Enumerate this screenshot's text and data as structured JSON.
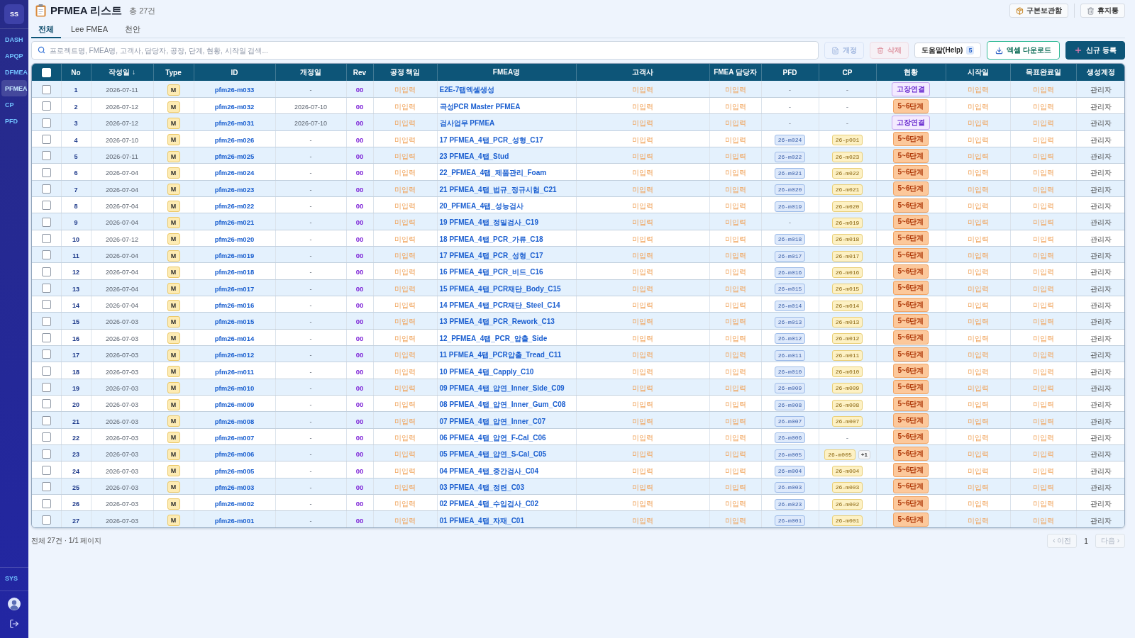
{
  "sidebar": {
    "logo": "SS",
    "items": [
      {
        "label": "DASH",
        "selected": false
      },
      {
        "label": "APQP",
        "selected": false
      },
      {
        "label": "DFMEA",
        "selected": false
      },
      {
        "label": "PFMEA",
        "selected": true
      },
      {
        "label": "CP",
        "selected": false
      },
      {
        "label": "PFD",
        "selected": false
      }
    ],
    "bottom_items": [
      {
        "label": "SYS",
        "selected": false
      }
    ]
  },
  "header": {
    "title": "PFMEA 리스트",
    "count": "총 27건",
    "actions": [
      {
        "label": "구본보관함",
        "kind": "archive"
      },
      {
        "label": "휴지통",
        "kind": "trash"
      }
    ]
  },
  "tabs": [
    {
      "label": "전체",
      "selected": true
    },
    {
      "label": "Lee FMEA",
      "selected": false
    },
    {
      "label": "천안",
      "selected": false
    }
  ],
  "search": {
    "placeholder": "프로젝트명, FMEA명, 고객사, 담당자, 공장, 단계, 현황, 시작일 검색..."
  },
  "toolbar": [
    {
      "label": "개정",
      "kind": "revise",
      "disabled": true
    },
    {
      "label": "삭제",
      "kind": "delete",
      "disabled": true
    },
    {
      "label": "도움말(Help)",
      "kind": "help",
      "disabled": false,
      "badge": "5"
    },
    {
      "label": "엑셀 다운로드",
      "kind": "excel",
      "disabled": false
    },
    {
      "label": "신규 등록",
      "kind": "create",
      "disabled": false
    }
  ],
  "table": {
    "select_all_checked": false,
    "columns": [
      "No",
      "작성일 ↓",
      "Type",
      "ID",
      "개정일",
      "Rev",
      "공정 책임",
      "FMEA명",
      "고객사",
      "FMEA 담당자",
      "PFD",
      "CP",
      "현황",
      "시작일",
      "목표완료일",
      "생성계정"
    ],
    "rows": [
      {
        "checked": false,
        "no": "1",
        "created": "2026-07-11",
        "type": "M",
        "id": "pfm26-m033",
        "revised": "-",
        "rev": "00",
        "process_owner": "미입력",
        "fmea_name": "E2E-7탭엑셀생성",
        "customer": "미입력",
        "fmea_owner": "미입력",
        "pfd": {
          "kind": "empty",
          "text": "-"
        },
        "cp": {
          "kind": "empty",
          "text": "-"
        },
        "status": {
          "kind": "link",
          "text": "고장연결"
        },
        "start": "미입력",
        "target": "미입력",
        "account": "관리자"
      },
      {
        "checked": false,
        "no": "2",
        "created": "2026-07-12",
        "type": "M",
        "id": "pfm26-m032",
        "revised": "2026-07-10",
        "rev": "00",
        "process_owner": "미입력",
        "fmea_name": "곡성PCR Master PFMEA",
        "customer": "미입력",
        "fmea_owner": "미입력",
        "pfd": {
          "kind": "empty",
          "text": "-"
        },
        "cp": {
          "kind": "empty",
          "text": "-"
        },
        "status": {
          "kind": "stage",
          "text": "5~6단계"
        },
        "start": "미입력",
        "target": "미입력",
        "account": "관리자"
      },
      {
        "checked": false,
        "no": "3",
        "created": "2026-07-12",
        "type": "M",
        "id": "pfm26-m031",
        "revised": "2026-07-10",
        "rev": "00",
        "process_owner": "미입력",
        "fmea_name": "검사업무 PFMEA",
        "customer": "미입력",
        "fmea_owner": "미입력",
        "pfd": {
          "kind": "empty",
          "text": "-"
        },
        "cp": {
          "kind": "empty",
          "text": "-"
        },
        "status": {
          "kind": "link",
          "text": "고장연결"
        },
        "start": "미입력",
        "target": "미입력",
        "account": "관리자"
      },
      {
        "checked": false,
        "no": "4",
        "created": "2026-07-10",
        "type": "M",
        "id": "pfm26-m026",
        "revised": "-",
        "rev": "00",
        "process_owner": "미입력",
        "fmea_name": "17 PFMEA_4탭_PCR_성형_C17",
        "customer": "미입력",
        "fmea_owner": "미입력",
        "pfd": {
          "kind": "chip",
          "text": "26-m024"
        },
        "cp": {
          "kind": "chip",
          "text": "26-p001"
        },
        "status": {
          "kind": "stage",
          "text": "5~6단계"
        },
        "start": "미입력",
        "target": "미입력",
        "account": "관리자"
      },
      {
        "checked": false,
        "no": "5",
        "created": "2026-07-11",
        "type": "M",
        "id": "pfm26-m025",
        "revised": "-",
        "rev": "00",
        "process_owner": "미입력",
        "fmea_name": "23 PFMEA_4탭_Stud",
        "customer": "미입력",
        "fmea_owner": "미입력",
        "pfd": {
          "kind": "chip",
          "text": "26-m022"
        },
        "cp": {
          "kind": "chip",
          "text": "26-m023"
        },
        "status": {
          "kind": "stage",
          "text": "5~6단계"
        },
        "start": "미입력",
        "target": "미입력",
        "account": "관리자"
      },
      {
        "checked": false,
        "no": "6",
        "created": "2026-07-04",
        "type": "M",
        "id": "pfm26-m024",
        "revised": "-",
        "rev": "00",
        "process_owner": "미입력",
        "fmea_name": "22_PFMEA_4탭_제품관리_Foam",
        "customer": "미입력",
        "fmea_owner": "미입력",
        "pfd": {
          "kind": "chip",
          "text": "26-m021"
        },
        "cp": {
          "kind": "chip",
          "text": "26-m022"
        },
        "status": {
          "kind": "stage",
          "text": "5~6단계"
        },
        "start": "미입력",
        "target": "미입력",
        "account": "관리자"
      },
      {
        "checked": false,
        "no": "7",
        "created": "2026-07-04",
        "type": "M",
        "id": "pfm26-m023",
        "revised": "-",
        "rev": "00",
        "process_owner": "미입력",
        "fmea_name": "21 PFMEA_4탭_법규_정규시험_C21",
        "customer": "미입력",
        "fmea_owner": "미입력",
        "pfd": {
          "kind": "chip",
          "text": "26-m020"
        },
        "cp": {
          "kind": "chip",
          "text": "26-m021"
        },
        "status": {
          "kind": "stage",
          "text": "5~6단계"
        },
        "start": "미입력",
        "target": "미입력",
        "account": "관리자"
      },
      {
        "checked": false,
        "no": "8",
        "created": "2026-07-04",
        "type": "M",
        "id": "pfm26-m022",
        "revised": "-",
        "rev": "00",
        "process_owner": "미입력",
        "fmea_name": "20_PFMEA_4탭_성능검사",
        "customer": "미입력",
        "fmea_owner": "미입력",
        "pfd": {
          "kind": "chip",
          "text": "26-m019"
        },
        "cp": {
          "kind": "chip",
          "text": "26-m020"
        },
        "status": {
          "kind": "stage",
          "text": "5~6단계"
        },
        "start": "미입력",
        "target": "미입력",
        "account": "관리자"
      },
      {
        "checked": false,
        "no": "9",
        "created": "2026-07-04",
        "type": "M",
        "id": "pfm26-m021",
        "revised": "-",
        "rev": "00",
        "process_owner": "미입력",
        "fmea_name": "19 PFMEA_4탭_정밀검사_C19",
        "customer": "미입력",
        "fmea_owner": "미입력",
        "pfd": {
          "kind": "empty",
          "text": "-"
        },
        "cp": {
          "kind": "chip",
          "text": "26-m019"
        },
        "status": {
          "kind": "stage",
          "text": "5~6단계"
        },
        "start": "미입력",
        "target": "미입력",
        "account": "관리자"
      },
      {
        "checked": false,
        "no": "10",
        "created": "2026-07-12",
        "type": "M",
        "id": "pfm26-m020",
        "revised": "-",
        "rev": "00",
        "process_owner": "미입력",
        "fmea_name": "18 PFMEA_4탭_PCR_가류_C18",
        "customer": "미입력",
        "fmea_owner": "미입력",
        "pfd": {
          "kind": "chip",
          "text": "26-m018"
        },
        "cp": {
          "kind": "chip",
          "text": "26-m018"
        },
        "status": {
          "kind": "stage",
          "text": "5~6단계"
        },
        "start": "미입력",
        "target": "미입력",
        "account": "관리자"
      },
      {
        "checked": false,
        "no": "11",
        "created": "2026-07-04",
        "type": "M",
        "id": "pfm26-m019",
        "revised": "-",
        "rev": "00",
        "process_owner": "미입력",
        "fmea_name": "17 PFMEA_4탭_PCR_성형_C17",
        "customer": "미입력",
        "fmea_owner": "미입력",
        "pfd": {
          "kind": "chip",
          "text": "26-m017"
        },
        "cp": {
          "kind": "chip",
          "text": "26-m017"
        },
        "status": {
          "kind": "stage",
          "text": "5~6단계"
        },
        "start": "미입력",
        "target": "미입력",
        "account": "관리자"
      },
      {
        "checked": false,
        "no": "12",
        "created": "2026-07-04",
        "type": "M",
        "id": "pfm26-m018",
        "revised": "-",
        "rev": "00",
        "process_owner": "미입력",
        "fmea_name": "16 PFMEA_4탭_PCR_비드_C16",
        "customer": "미입력",
        "fmea_owner": "미입력",
        "pfd": {
          "kind": "chip",
          "text": "26-m016"
        },
        "cp": {
          "kind": "chip",
          "text": "26-m016"
        },
        "status": {
          "kind": "stage",
          "text": "5~6단계"
        },
        "start": "미입력",
        "target": "미입력",
        "account": "관리자"
      },
      {
        "checked": false,
        "no": "13",
        "created": "2026-07-04",
        "type": "M",
        "id": "pfm26-m017",
        "revised": "-",
        "rev": "00",
        "process_owner": "미입력",
        "fmea_name": "15 PFMEA_4탭_PCR재단_Body_C15",
        "customer": "미입력",
        "fmea_owner": "미입력",
        "pfd": {
          "kind": "chip",
          "text": "26-m015"
        },
        "cp": {
          "kind": "chip",
          "text": "26-m015"
        },
        "status": {
          "kind": "stage",
          "text": "5~6단계"
        },
        "start": "미입력",
        "target": "미입력",
        "account": "관리자"
      },
      {
        "checked": false,
        "no": "14",
        "created": "2026-07-04",
        "type": "M",
        "id": "pfm26-m016",
        "revised": "-",
        "rev": "00",
        "process_owner": "미입력",
        "fmea_name": "14 PFMEA_4탭_PCR재단_Steel_C14",
        "customer": "미입력",
        "fmea_owner": "미입력",
        "pfd": {
          "kind": "chip",
          "text": "26-m014"
        },
        "cp": {
          "kind": "chip",
          "text": "26-m014"
        },
        "status": {
          "kind": "stage",
          "text": "5~6단계"
        },
        "start": "미입력",
        "target": "미입력",
        "account": "관리자"
      },
      {
        "checked": false,
        "no": "15",
        "created": "2026-07-03",
        "type": "M",
        "id": "pfm26-m015",
        "revised": "-",
        "rev": "00",
        "process_owner": "미입력",
        "fmea_name": "13 PFMEA_4탭_PCR_Rework_C13",
        "customer": "미입력",
        "fmea_owner": "미입력",
        "pfd": {
          "kind": "chip",
          "text": "26-m013"
        },
        "cp": {
          "kind": "chip",
          "text": "26-m013"
        },
        "status": {
          "kind": "stage",
          "text": "5~6단계"
        },
        "start": "미입력",
        "target": "미입력",
        "account": "관리자"
      },
      {
        "checked": false,
        "no": "16",
        "created": "2026-07-03",
        "type": "M",
        "id": "pfm26-m014",
        "revised": "-",
        "rev": "00",
        "process_owner": "미입력",
        "fmea_name": "12_PFMEA_4탭_PCR_압출_Side",
        "customer": "미입력",
        "fmea_owner": "미입력",
        "pfd": {
          "kind": "chip",
          "text": "26-m012"
        },
        "cp": {
          "kind": "chip",
          "text": "26-m012"
        },
        "status": {
          "kind": "stage",
          "text": "5~6단계"
        },
        "start": "미입력",
        "target": "미입력",
        "account": "관리자"
      },
      {
        "checked": false,
        "no": "17",
        "created": "2026-07-03",
        "type": "M",
        "id": "pfm26-m012",
        "revised": "-",
        "rev": "00",
        "process_owner": "미입력",
        "fmea_name": "11 PFMEA_4탭_PCR압출_Tread_C11",
        "customer": "미입력",
        "fmea_owner": "미입력",
        "pfd": {
          "kind": "chip",
          "text": "26-m011"
        },
        "cp": {
          "kind": "chip",
          "text": "26-m011"
        },
        "status": {
          "kind": "stage",
          "text": "5~6단계"
        },
        "start": "미입력",
        "target": "미입력",
        "account": "관리자"
      },
      {
        "checked": false,
        "no": "18",
        "created": "2026-07-03",
        "type": "M",
        "id": "pfm26-m011",
        "revised": "-",
        "rev": "00",
        "process_owner": "미입력",
        "fmea_name": "10 PFMEA_4탭_Capply_C10",
        "customer": "미입력",
        "fmea_owner": "미입력",
        "pfd": {
          "kind": "chip",
          "text": "26-m010"
        },
        "cp": {
          "kind": "chip",
          "text": "26-m010"
        },
        "status": {
          "kind": "stage",
          "text": "5~6단계"
        },
        "start": "미입력",
        "target": "미입력",
        "account": "관리자"
      },
      {
        "checked": false,
        "no": "19",
        "created": "2026-07-03",
        "type": "M",
        "id": "pfm26-m010",
        "revised": "-",
        "rev": "00",
        "process_owner": "미입력",
        "fmea_name": "09 PFMEA_4탭_압연_Inner_Side_C09",
        "customer": "미입력",
        "fmea_owner": "미입력",
        "pfd": {
          "kind": "chip",
          "text": "26-m009"
        },
        "cp": {
          "kind": "chip",
          "text": "26-m009"
        },
        "status": {
          "kind": "stage",
          "text": "5~6단계"
        },
        "start": "미입력",
        "target": "미입력",
        "account": "관리자"
      },
      {
        "checked": false,
        "no": "20",
        "created": "2026-07-03",
        "type": "M",
        "id": "pfm26-m009",
        "revised": "-",
        "rev": "00",
        "process_owner": "미입력",
        "fmea_name": "08 PFMEA_4탭_압연_Inner_Gum_C08",
        "customer": "미입력",
        "fmea_owner": "미입력",
        "pfd": {
          "kind": "chip",
          "text": "26-m008"
        },
        "cp": {
          "kind": "chip",
          "text": "26-m008"
        },
        "status": {
          "kind": "stage",
          "text": "5~6단계"
        },
        "start": "미입력",
        "target": "미입력",
        "account": "관리자"
      },
      {
        "checked": false,
        "no": "21",
        "created": "2026-07-03",
        "type": "M",
        "id": "pfm26-m008",
        "revised": "-",
        "rev": "00",
        "process_owner": "미입력",
        "fmea_name": "07 PFMEA_4탭_압연_Inner_C07",
        "customer": "미입력",
        "fmea_owner": "미입력",
        "pfd": {
          "kind": "chip",
          "text": "26-m007"
        },
        "cp": {
          "kind": "chip",
          "text": "26-m007"
        },
        "status": {
          "kind": "stage",
          "text": "5~6단계"
        },
        "start": "미입력",
        "target": "미입력",
        "account": "관리자"
      },
      {
        "checked": false,
        "no": "22",
        "created": "2026-07-03",
        "type": "M",
        "id": "pfm26-m007",
        "revised": "-",
        "rev": "00",
        "process_owner": "미입력",
        "fmea_name": "06 PFMEA_4탭_압연_F-Cal_C06",
        "customer": "미입력",
        "fmea_owner": "미입력",
        "pfd": {
          "kind": "chip",
          "text": "26-m006"
        },
        "cp": {
          "kind": "empty",
          "text": "-"
        },
        "status": {
          "kind": "stage",
          "text": "5~6단계"
        },
        "start": "미입력",
        "target": "미입력",
        "account": "관리자"
      },
      {
        "checked": false,
        "no": "23",
        "created": "2026-07-03",
        "type": "M",
        "id": "pfm26-m006",
        "revised": "-",
        "rev": "00",
        "process_owner": "미입력",
        "fmea_name": "05 PFMEA_4탭_압연_S-Cal_C05",
        "customer": "미입력",
        "fmea_owner": "미입력",
        "pfd": {
          "kind": "chip",
          "text": "26-m005"
        },
        "cp": {
          "kind": "chip",
          "text": "26-m005",
          "more": "+1"
        },
        "status": {
          "kind": "stage",
          "text": "5~6단계"
        },
        "start": "미입력",
        "target": "미입력",
        "account": "관리자"
      },
      {
        "checked": false,
        "no": "24",
        "created": "2026-07-03",
        "type": "M",
        "id": "pfm26-m005",
        "revised": "-",
        "rev": "00",
        "process_owner": "미입력",
        "fmea_name": "04 PFMEA_4탭_중간검사_C04",
        "customer": "미입력",
        "fmea_owner": "미입력",
        "pfd": {
          "kind": "chip",
          "text": "26-m004"
        },
        "cp": {
          "kind": "chip",
          "text": "26-m004"
        },
        "status": {
          "kind": "stage",
          "text": "5~6단계"
        },
        "start": "미입력",
        "target": "미입력",
        "account": "관리자"
      },
      {
        "checked": false,
        "no": "25",
        "created": "2026-07-03",
        "type": "M",
        "id": "pfm26-m003",
        "revised": "-",
        "rev": "00",
        "process_owner": "미입력",
        "fmea_name": "03 PFMEA_4탭_정련_C03",
        "customer": "미입력",
        "fmea_owner": "미입력",
        "pfd": {
          "kind": "chip",
          "text": "26-m003"
        },
        "cp": {
          "kind": "chip",
          "text": "26-m003"
        },
        "status": {
          "kind": "stage",
          "text": "5~6단계"
        },
        "start": "미입력",
        "target": "미입력",
        "account": "관리자"
      },
      {
        "checked": false,
        "no": "26",
        "created": "2026-07-03",
        "type": "M",
        "id": "pfm26-m002",
        "revised": "-",
        "rev": "00",
        "process_owner": "미입력",
        "fmea_name": "02 PFMEA_4탭_수입검사_C02",
        "customer": "미입력",
        "fmea_owner": "미입력",
        "pfd": {
          "kind": "chip",
          "text": "26-m023"
        },
        "cp": {
          "kind": "chip",
          "text": "26-m002"
        },
        "status": {
          "kind": "stage",
          "text": "5~6단계"
        },
        "start": "미입력",
        "target": "미입력",
        "account": "관리자"
      },
      {
        "checked": false,
        "no": "27",
        "created": "2026-07-03",
        "type": "M",
        "id": "pfm26-m001",
        "revised": "-",
        "rev": "00",
        "process_owner": "미입력",
        "fmea_name": "01 PFMEA_4탭_자재_C01",
        "customer": "미입력",
        "fmea_owner": "미입력",
        "pfd": {
          "kind": "chip",
          "text": "26-m001"
        },
        "cp": {
          "kind": "chip",
          "text": "26-m001"
        },
        "status": {
          "kind": "stage",
          "text": "5~6단계"
        },
        "start": "미입력",
        "target": "미입력",
        "account": "관리자"
      }
    ]
  },
  "footer": {
    "summary": "전체 27건 · 1/1 페이지",
    "pagination": {
      "prev": {
        "label": "‹ 이전",
        "disabled": true
      },
      "current_page": "1",
      "next": {
        "label": "다음 ›",
        "disabled": true
      }
    }
  }
}
